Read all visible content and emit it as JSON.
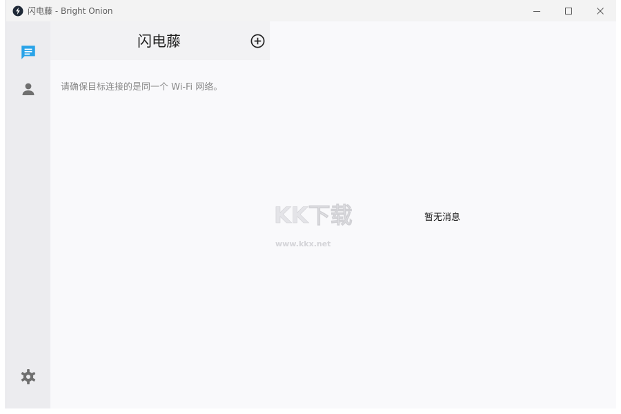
{
  "window": {
    "title": "闪电藤 - Bright Onion"
  },
  "sidebar": {
    "items": [
      {
        "name": "messages",
        "icon": "chat-icon",
        "active": true
      },
      {
        "name": "contacts",
        "icon": "person-icon",
        "active": false
      }
    ],
    "settings_icon": "gear-icon"
  },
  "conversation_list": {
    "title": "闪电藤",
    "add_icon": "plus-circle-icon",
    "wifi_hint": "请确保目标连接的是同一个 Wi-Fi 网络。"
  },
  "chat_panel": {
    "empty_text": "暂无消息"
  },
  "watermark": {
    "logo_text": "KK下载",
    "url": "www.kkx.net"
  },
  "colors": {
    "accent": "#29a3e8",
    "icon_gray": "#6f6f6f",
    "sidebar_bg": "#ececef"
  }
}
